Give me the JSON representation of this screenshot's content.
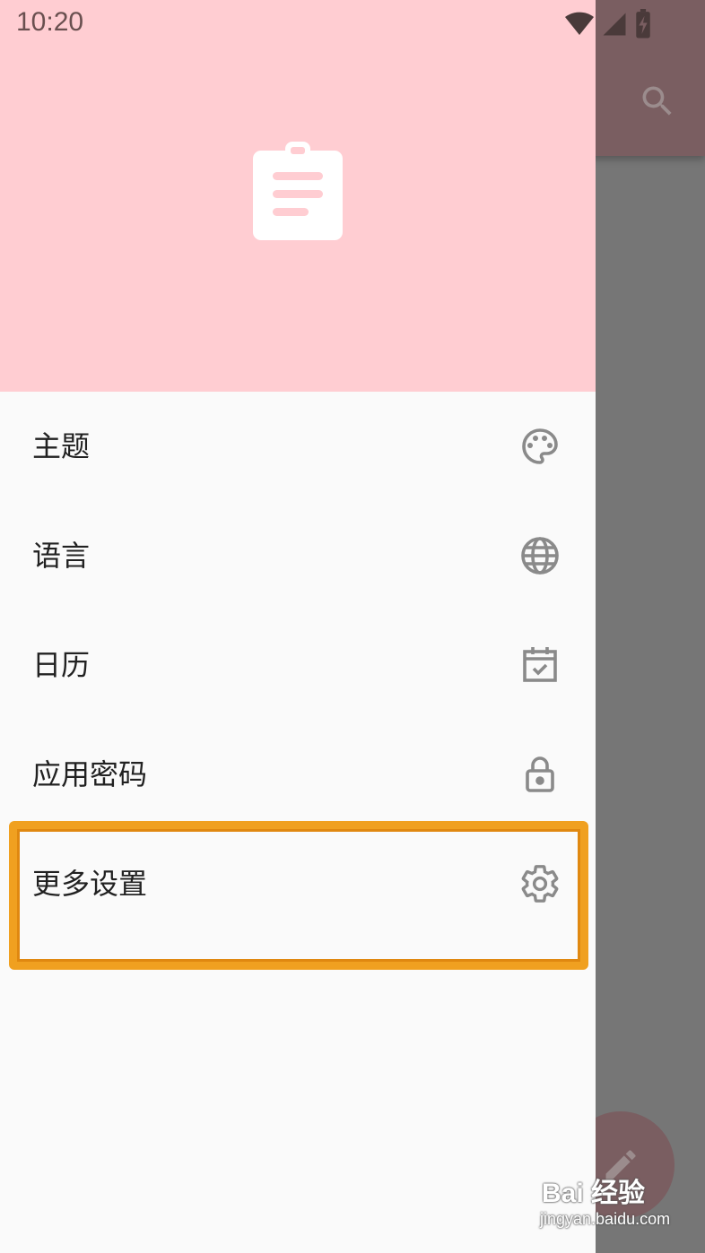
{
  "status_bar": {
    "time": "10:20",
    "icons": [
      "wifi-icon",
      "signal-icon",
      "battery-charging-icon"
    ]
  },
  "colors": {
    "header_bg": "#ffcdd2",
    "drawer_bg": "#fafafa",
    "scrim": "#767676",
    "toolbar_dim": "#7a5e61",
    "icon_gray": "#8a8a8a",
    "highlight": "#f0a020"
  },
  "background_app": {
    "toolbar_icon": "search-icon",
    "fab_icon": "edit-icon"
  },
  "drawer": {
    "header_icon": "clipboard-icon",
    "items": [
      {
        "label": "主题",
        "icon": "palette-icon"
      },
      {
        "label": "语言",
        "icon": "globe-icon"
      },
      {
        "label": "日历",
        "icon": "calendar-check-icon"
      },
      {
        "label": "应用密码",
        "icon": "lock-icon"
      },
      {
        "label": "更多设置",
        "icon": "gear-icon",
        "highlighted": true
      }
    ]
  },
  "watermark": {
    "main": "Bai 经验",
    "sub": "jingyan.baidu.com"
  }
}
